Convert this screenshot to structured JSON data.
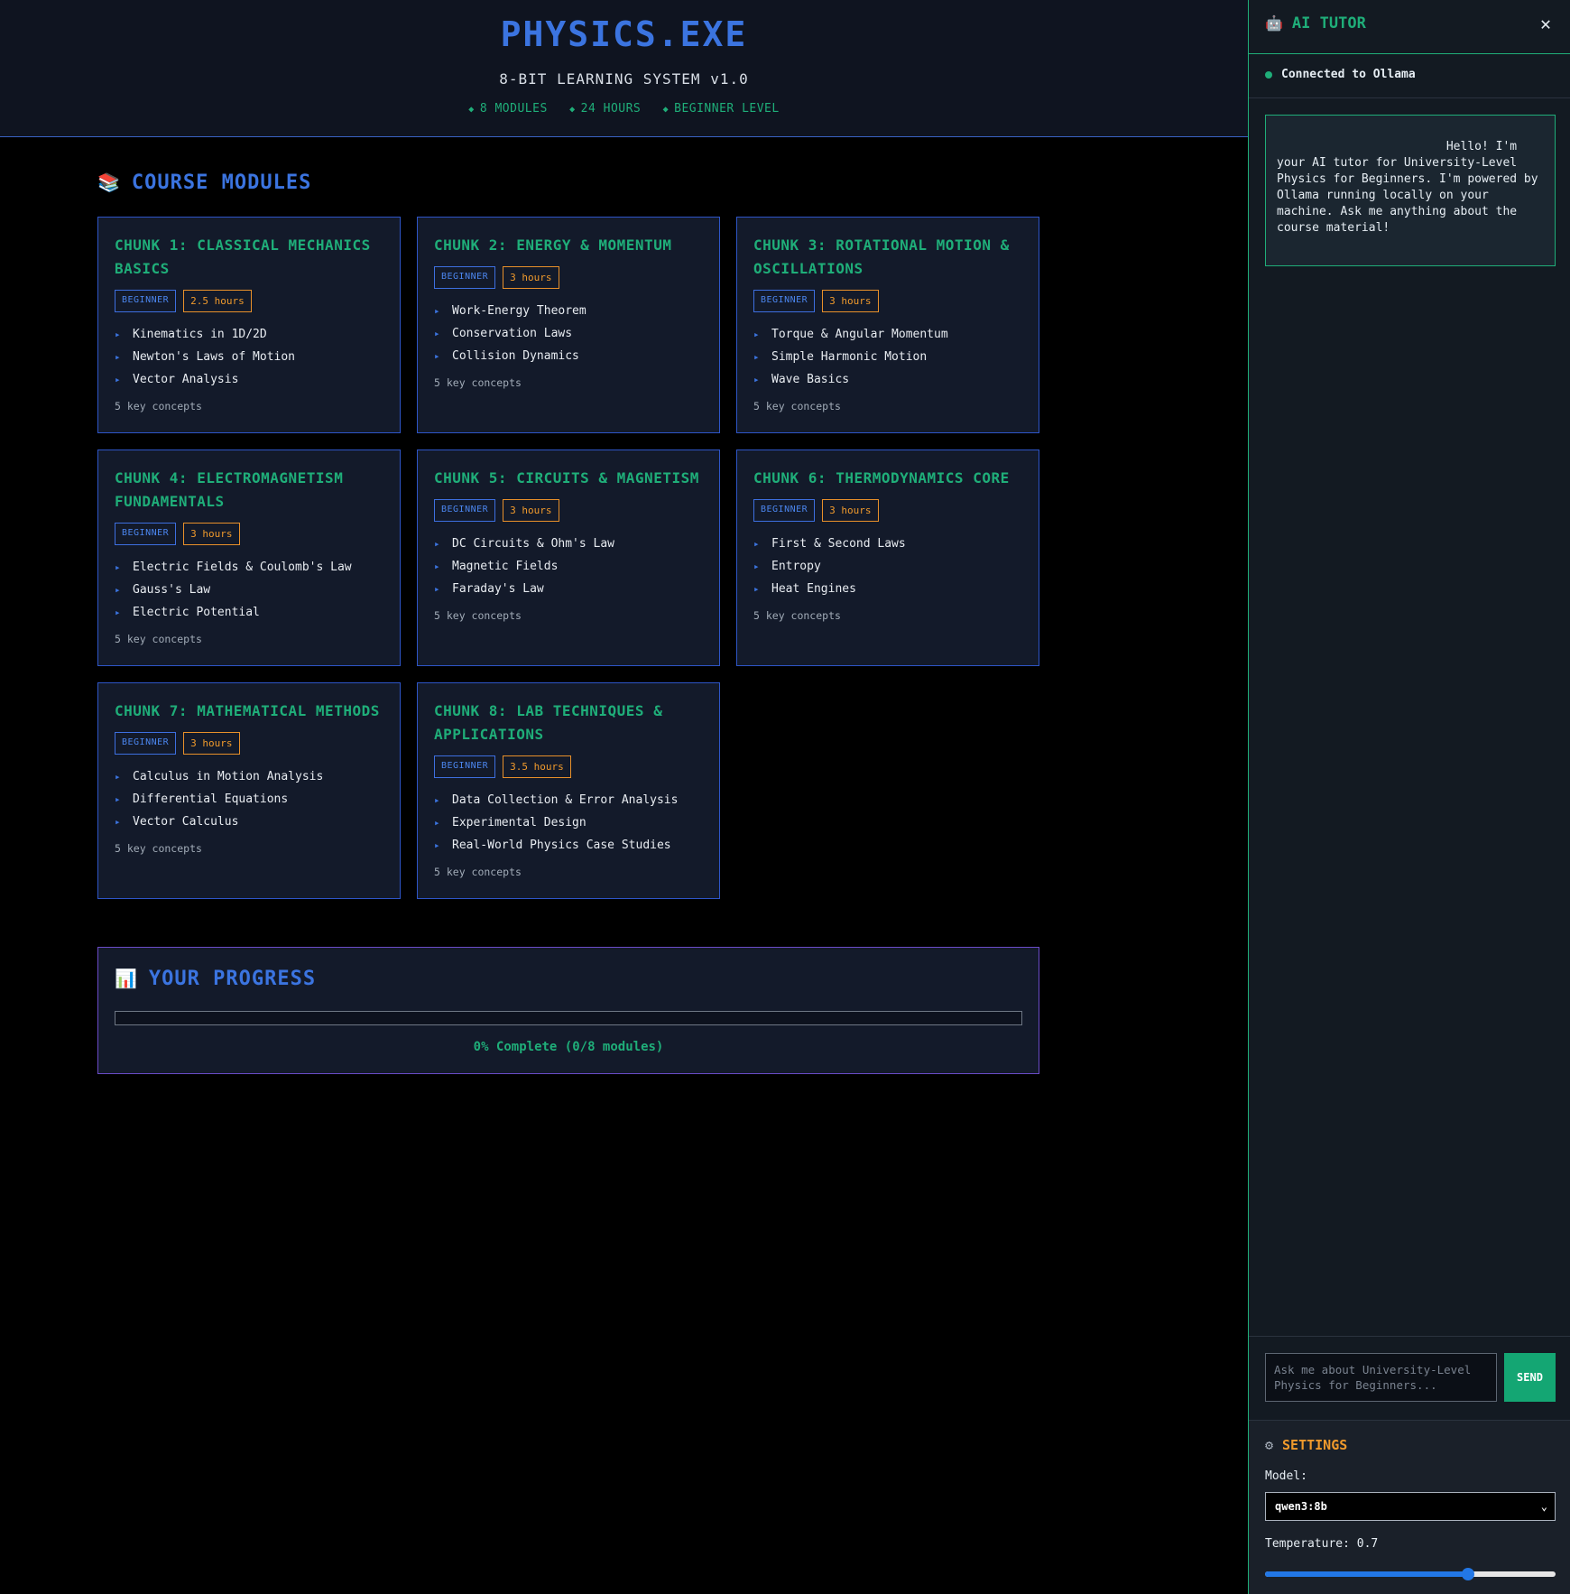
{
  "header": {
    "title": "PHYSICS.EXE",
    "subtitle": "8-BIT LEARNING SYSTEM v1.0",
    "stats": [
      "8 MODULES",
      "24 HOURS",
      "BEGINNER LEVEL"
    ]
  },
  "modules_section": {
    "icon": "books-icon",
    "icon_glyph": "📚",
    "title": "COURSE MODULES"
  },
  "modules": [
    {
      "title": "Chunk 1: Classical Mechanics Basics",
      "level": "BEGINNER",
      "hours": "2.5 hours",
      "topics": [
        "Kinematics in 1D/2D",
        "Newton's Laws of Motion",
        "Vector Analysis"
      ],
      "concepts": "5 key concepts"
    },
    {
      "title": "Chunk 2: Energy & Momentum",
      "level": "BEGINNER",
      "hours": "3 hours",
      "topics": [
        "Work-Energy Theorem",
        "Conservation Laws",
        "Collision Dynamics"
      ],
      "concepts": "5 key concepts"
    },
    {
      "title": "Chunk 3: Rotational Motion & Oscillations",
      "level": "BEGINNER",
      "hours": "3 hours",
      "topics": [
        "Torque & Angular Momentum",
        "Simple Harmonic Motion",
        "Wave Basics"
      ],
      "concepts": "5 key concepts"
    },
    {
      "title": "Chunk 4: Electromagnetism Fundamentals",
      "level": "BEGINNER",
      "hours": "3 hours",
      "topics": [
        "Electric Fields & Coulomb's Law",
        "Gauss's Law",
        "Electric Potential"
      ],
      "concepts": "5 key concepts"
    },
    {
      "title": "Chunk 5: Circuits & Magnetism",
      "level": "BEGINNER",
      "hours": "3 hours",
      "topics": [
        "DC Circuits & Ohm's Law",
        "Magnetic Fields",
        "Faraday's Law"
      ],
      "concepts": "5 key concepts"
    },
    {
      "title": "Chunk 6: Thermodynamics Core",
      "level": "BEGINNER",
      "hours": "3 hours",
      "topics": [
        "First & Second Laws",
        "Entropy",
        "Heat Engines"
      ],
      "concepts": "5 key concepts"
    },
    {
      "title": "Chunk 7: Mathematical Methods",
      "level": "BEGINNER",
      "hours": "3 hours",
      "topics": [
        "Calculus in Motion Analysis",
        "Differential Equations",
        "Vector Calculus"
      ],
      "concepts": "5 key concepts"
    },
    {
      "title": "Chunk 8: Lab Techniques & Applications",
      "level": "BEGINNER",
      "hours": "3.5 hours",
      "topics": [
        "Data Collection & Error Analysis",
        "Experimental Design",
        "Real-World Physics Case Studies"
      ],
      "concepts": "5 key concepts"
    }
  ],
  "progress": {
    "icon": "bar-chart-icon",
    "icon_glyph": "📊",
    "title": "YOUR PROGRESS",
    "percent": 0,
    "text": "0% Complete (0/8 modules)"
  },
  "tutor": {
    "icon": "robot-icon",
    "icon_glyph": "🤖",
    "title": "AI TUTOR",
    "close_glyph": "✕",
    "status": "Connected to Ollama",
    "message": "                        Hello! I'm your AI tutor for University-Level Physics for Beginners. I'm powered by Ollama running locally on your machine. Ask me anything about the course material!",
    "input_placeholder": "Ask me about University-Level Physics for Beginners...",
    "send_label": "SEND"
  },
  "settings": {
    "icon": "gear-icon",
    "icon_glyph": "⚙",
    "title": "SETTINGS",
    "model_label": "Model:",
    "model_value": "qwen3:8b",
    "temperature_label": "Temperature: 0.7",
    "temperature": 0.7,
    "temperature_max": 1.0
  },
  "colors": {
    "accent_blue": "#3b74e0",
    "accent_green": "#1fae79",
    "accent_orange": "#f09a2c",
    "progress_border": "#6a4bc7"
  }
}
